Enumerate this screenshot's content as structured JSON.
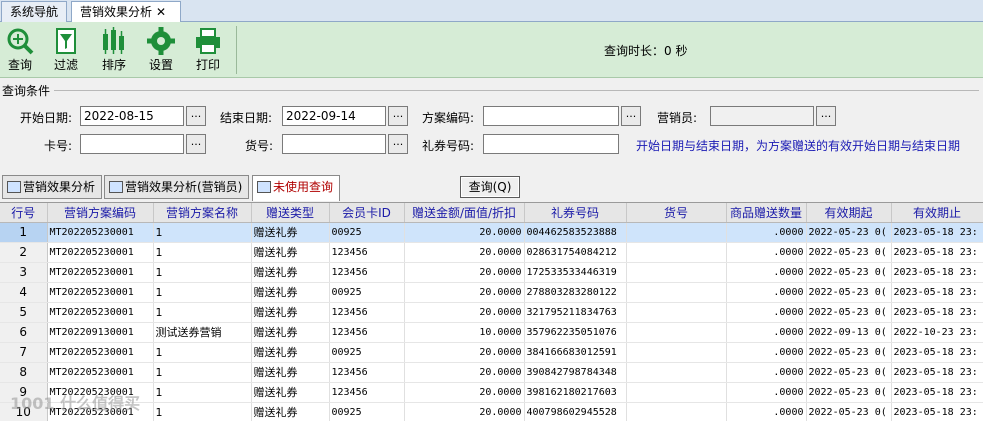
{
  "tabs": [
    {
      "label": "系统导航"
    },
    {
      "label": "营销效果分析"
    }
  ],
  "toolbar": {
    "buttons": [
      {
        "label": "查询",
        "icon": "magnifier-icon"
      },
      {
        "label": "过滤",
        "icon": "filter-icon"
      },
      {
        "label": "排序",
        "icon": "sort-icon"
      },
      {
        "label": "设置",
        "icon": "gear-icon"
      },
      {
        "label": "打印",
        "icon": "printer-icon"
      }
    ],
    "query_time": "查询时长：0 秒"
  },
  "query": {
    "title": "查询条件",
    "start_date_label": "开始日期:",
    "start_date": "2022-08-15",
    "end_date_label": "结束日期:",
    "end_date": "2022-09-14",
    "plan_code_label": "方案编码:",
    "plan_code": "",
    "salesman_label": "营销员:",
    "salesman": "",
    "card_label": "卡号:",
    "card": "",
    "goods_label": "货号:",
    "goods": "",
    "coupon_label": "礼券号码:",
    "coupon": "",
    "ellipsis": "...",
    "hint": "开始日期与结束日期，为方案赠送的有效开始日期与结束日期"
  },
  "subtabs": [
    {
      "label": "营销效果分析"
    },
    {
      "label": "营销效果分析(营销员)"
    },
    {
      "label": "未使用查询"
    }
  ],
  "query_button": "查询(Q)",
  "grid": {
    "columns": [
      "行号",
      "营销方案编码",
      "营销方案名称",
      "赠送类型",
      "会员卡ID",
      "赠送金额/面值/折扣",
      "礼券号码",
      "货号",
      "商品赠送数量",
      "有效期起",
      "有效期止"
    ],
    "rows": [
      [
        "1",
        "MT202205230001",
        "1",
        "赠送礼券",
        "00925",
        "20.0000",
        "004462583523888",
        "",
        ".0000",
        "2022-05-23 0(",
        "2023-05-18 23:"
      ],
      [
        "2",
        "MT202205230001",
        "1",
        "赠送礼券",
        "123456",
        "20.0000",
        "028631754084212",
        "",
        ".0000",
        "2022-05-23 0(",
        "2023-05-18 23:"
      ],
      [
        "3",
        "MT202205230001",
        "1",
        "赠送礼券",
        "123456",
        "20.0000",
        "172533533446319",
        "",
        ".0000",
        "2022-05-23 0(",
        "2023-05-18 23:"
      ],
      [
        "4",
        "MT202205230001",
        "1",
        "赠送礼券",
        "00925",
        "20.0000",
        "278803283280122",
        "",
        ".0000",
        "2022-05-23 0(",
        "2023-05-18 23:"
      ],
      [
        "5",
        "MT202205230001",
        "1",
        "赠送礼券",
        "123456",
        "20.0000",
        "321795211834763",
        "",
        ".0000",
        "2022-05-23 0(",
        "2023-05-18 23:"
      ],
      [
        "6",
        "MT202209130001",
        "测试送券营销",
        "赠送礼券",
        "123456",
        "10.0000",
        "357962235051076",
        "",
        ".0000",
        "2022-09-13 0(",
        "2022-10-23 23:"
      ],
      [
        "7",
        "MT202205230001",
        "1",
        "赠送礼券",
        "00925",
        "20.0000",
        "384166683012591",
        "",
        ".0000",
        "2022-05-23 0(",
        "2023-05-18 23:"
      ],
      [
        "8",
        "MT202205230001",
        "1",
        "赠送礼券",
        "123456",
        "20.0000",
        "390842798784348",
        "",
        ".0000",
        "2022-05-23 0(",
        "2023-05-18 23:"
      ],
      [
        "9",
        "MT202205230001",
        "1",
        "赠送礼券",
        "123456",
        "20.0000",
        "398162180217603",
        "",
        ".0000",
        "2022-05-23 0(",
        "2023-05-18 23:"
      ],
      [
        "10",
        "MT202205230001",
        "1",
        "赠送礼券",
        "00925",
        "20.0000",
        "400798602945528",
        "",
        ".0000",
        "2022-05-23 0(",
        "2023-05-18 23:"
      ]
    ]
  },
  "watermark": "1001 什么值得买",
  "colors": {
    "toolbar_bg": "#d6ecd6",
    "hint": "#1a1ab4",
    "header_text": "#1a1aa8",
    "selected_row": "#cfe4fb",
    "active_subtab": "#b00000"
  }
}
